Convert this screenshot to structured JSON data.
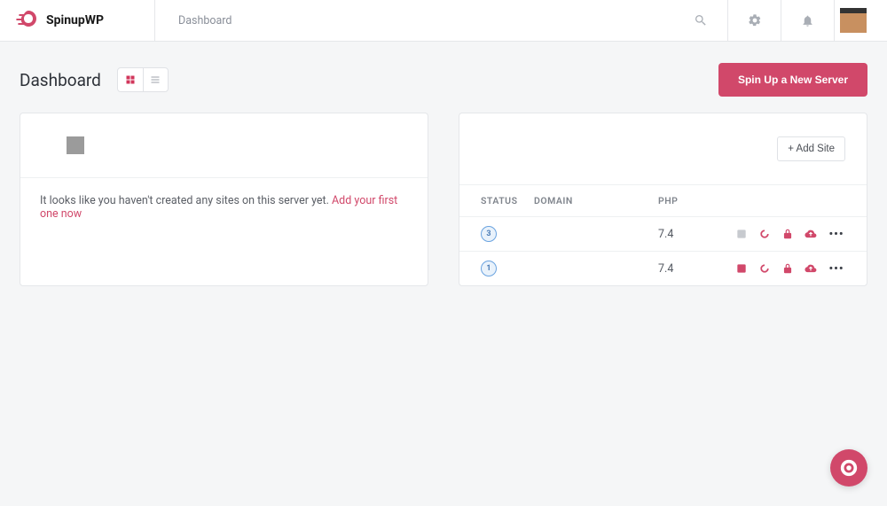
{
  "brand": {
    "name": "SpinupWP"
  },
  "breadcrumb": "Dashboard",
  "page": {
    "title": "Dashboard",
    "spin_up_button": "Spin Up a New Server"
  },
  "servers": {
    "empty": {
      "message": "It looks like you haven't created any sites on this server yet. ",
      "link": "Add your first one now"
    },
    "populated": {
      "add_site_label": "+ Add Site",
      "columns": {
        "status": "STATUS",
        "domain": "DOMAIN",
        "php": "PHP"
      },
      "rows": [
        {
          "status": "3",
          "domain": "",
          "php": "7.4",
          "git_muted": true
        },
        {
          "status": "1",
          "domain": "",
          "php": "7.4",
          "git_muted": false
        }
      ]
    }
  }
}
